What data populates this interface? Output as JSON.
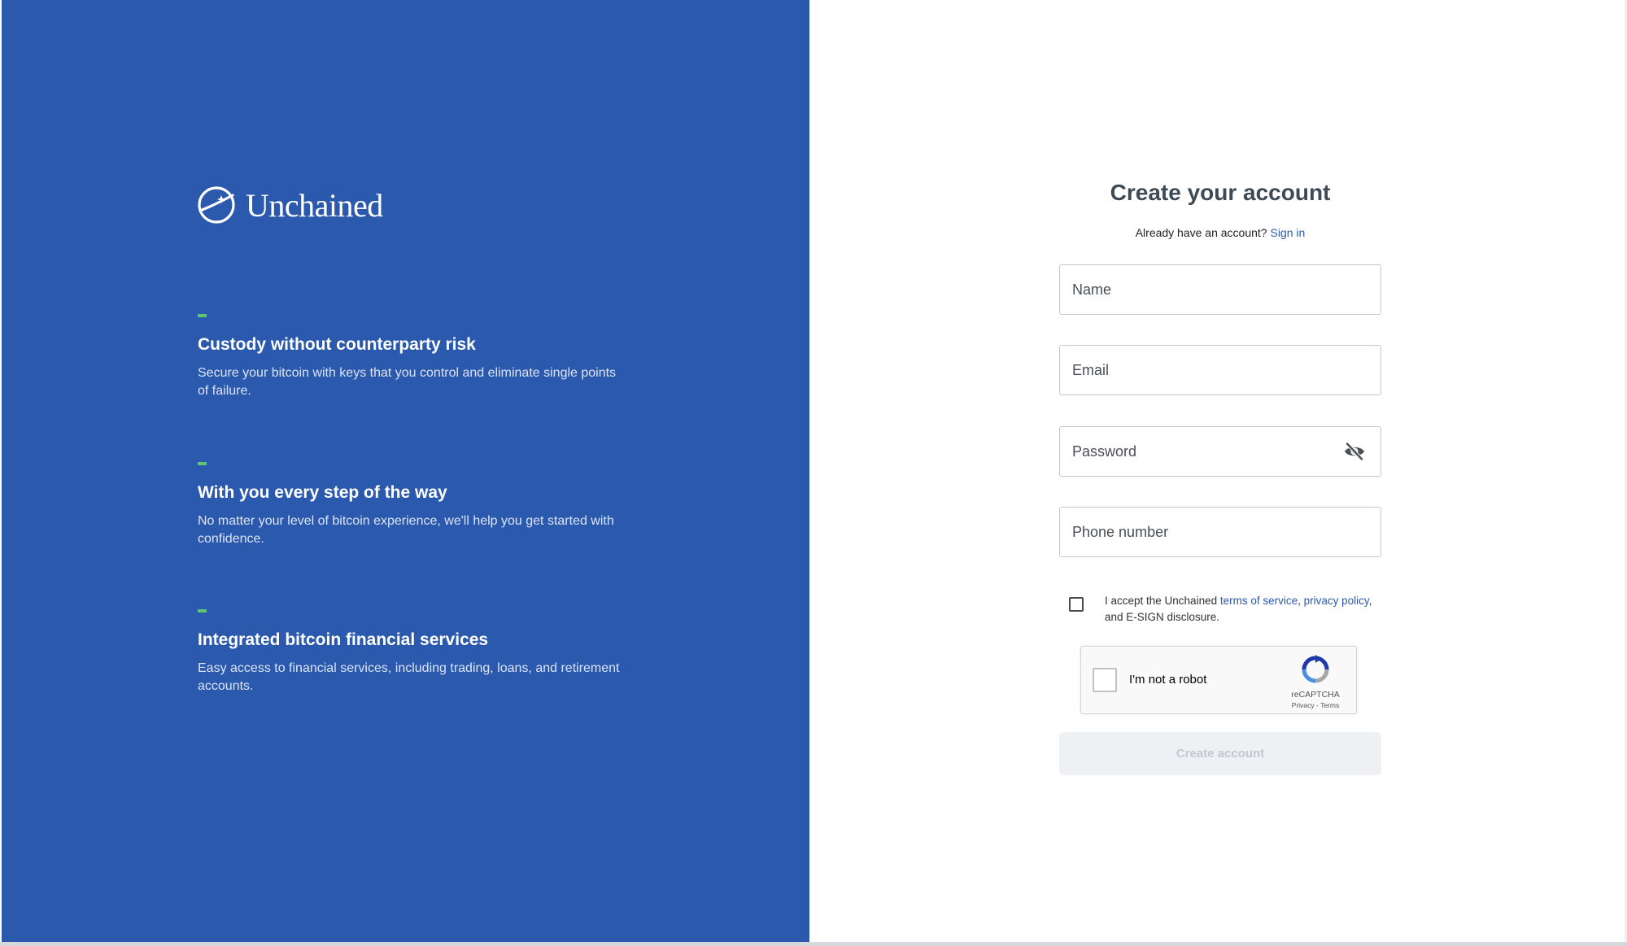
{
  "brand": {
    "name": "Unchained",
    "logo_icon": "unchained-logo-icon",
    "panel_color": "#2b59ae",
    "accent_color": "#5ec767"
  },
  "features": [
    {
      "title": "Custody without counterparty risk",
      "description": "Secure your bitcoin with keys that you control and eliminate single points of failure."
    },
    {
      "title": "With you every step of the way",
      "description": "No matter your level of bitcoin experience, we'll help you get started with confidence."
    },
    {
      "title": "Integrated bitcoin financial services",
      "description": "Easy access to financial services, including trading, loans, and retirement accounts."
    }
  ],
  "form": {
    "title": "Create your account",
    "signin_prompt": "Already have an account?",
    "signin_link": "Sign in",
    "name_placeholder": "Name",
    "email_placeholder": "Email",
    "password_placeholder": "Password",
    "phone_placeholder": "Phone number",
    "password_toggle_icon": "eye-slash-icon",
    "terms": {
      "prefix": "I accept the Unchained ",
      "tos_link": "terms of service",
      "separator": ", ",
      "privacy_link": "privacy policy",
      "suffix": ", and E-SIGN disclosure."
    },
    "submit_label": "Create account",
    "submit_disabled": true
  },
  "captcha": {
    "label": "I'm not a robot",
    "brand": "reCAPTCHA",
    "privacy": "Privacy",
    "links_separator": " - ",
    "terms": "Terms"
  }
}
